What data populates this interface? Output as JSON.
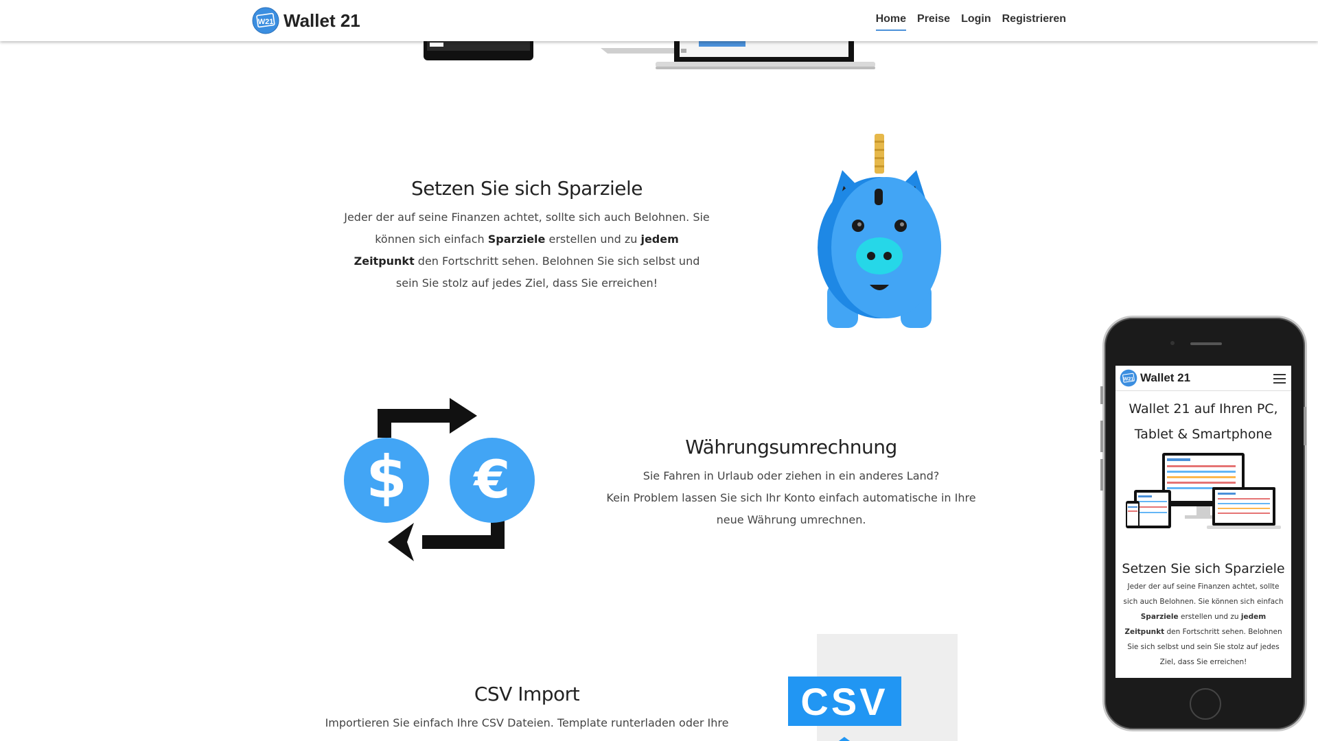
{
  "brand": {
    "name": "Wallet 21",
    "logo_text": "W21"
  },
  "nav": {
    "items": [
      {
        "label": "Home",
        "active": true
      },
      {
        "label": "Preise",
        "active": false
      },
      {
        "label": "Login",
        "active": false
      },
      {
        "label": "Registrieren",
        "active": false
      }
    ]
  },
  "features": {
    "savings": {
      "title": "Setzen Sie sich Sparziele",
      "text_1": "Jeder der auf seine Finanzen achtet, sollte sich auch Belohnen. Sie können sich einfach ",
      "bold_1": "Sparziele",
      "text_2": " erstellen und zu ",
      "bold_2": "jedem Zeitpunkt",
      "text_3": " den Fortschritt sehen. Belohnen Sie sich selbst und sein Sie stolz auf jedes Ziel, dass Sie erreichen!"
    },
    "currency": {
      "title": "Währungsumrechnung",
      "line_1": "Sie Fahren in Urlaub oder ziehen in ein anderes Land?",
      "line_2": "Kein Problem lassen Sie sich Ihr Konto einfach automatische in Ihre neue Währung umrechnen."
    },
    "csv": {
      "title": "CSV Import",
      "text": "Importieren Sie einfach Ihre CSV Dateien. Template runterladen oder Ihre",
      "icon_label": "CSV"
    }
  },
  "currency_icons": {
    "dollar": "$",
    "euro": "€"
  },
  "phone": {
    "brand_name": "Wallet 21",
    "hero_title_1": "Wallet 21 auf Ihren PC,",
    "hero_title_2": "Tablet & Smartphone",
    "feature_title": "Setzen Sie sich Sparziele",
    "text_1": "Jeder der auf seine Finanzen achtet, sollte sich auch Belohnen. Sie können sich einfach ",
    "bold_1": "Sparziele",
    "text_2": " erstellen und zu ",
    "bold_2": "jedem Zeitpunkt",
    "text_3": " den Fortschritt sehen. Belohnen Sie sich selbst und sein Sie stolz auf jedes Ziel, dass Sie erreichen!"
  },
  "colors": {
    "accent": "#4a90d9",
    "icon_blue": "#42a5f5",
    "pig_dark": "#1e88e5",
    "coin": "#e6b84a",
    "csv_blue": "#2196f3"
  }
}
